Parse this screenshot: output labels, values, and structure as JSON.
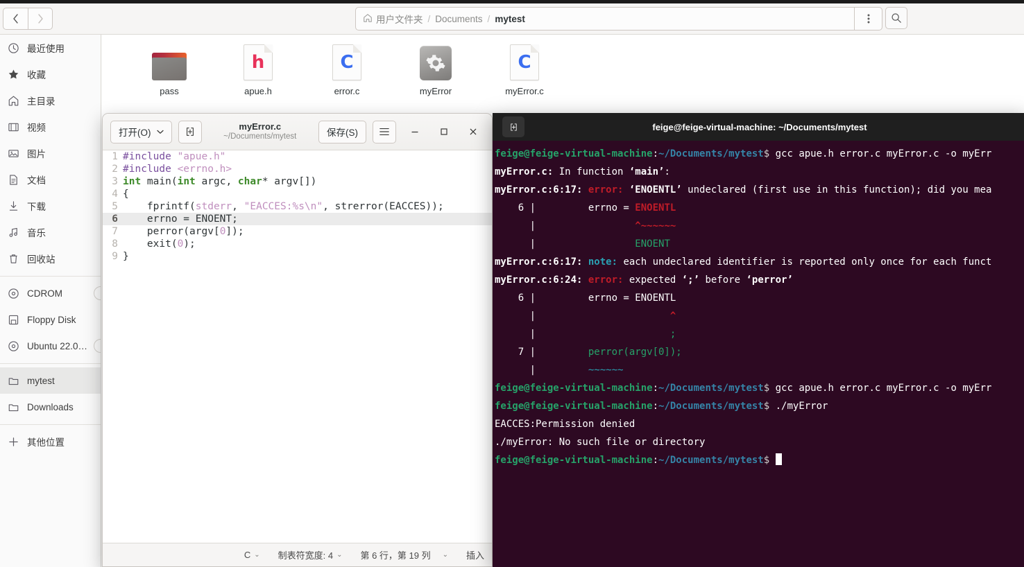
{
  "file_manager": {
    "nav": {
      "back_icon": "chevron-left-icon",
      "forward_icon": "chevron-right-icon"
    },
    "path": {
      "home_icon": "home-icon",
      "segments": [
        "用户文件夹",
        "Documents",
        "mytest"
      ],
      "separator": "/"
    },
    "menu_icon": "kebab-menu-icon",
    "search_icon": "search-icon",
    "sidebar": {
      "items": [
        {
          "label": "最近使用",
          "icon": "clock-icon",
          "selected": false,
          "eject": false
        },
        {
          "label": "收藏",
          "icon": "star-icon",
          "selected": false,
          "eject": false
        },
        {
          "label": "主目录",
          "icon": "home-icon",
          "selected": false,
          "eject": false
        },
        {
          "label": "视频",
          "icon": "video-icon",
          "selected": false,
          "eject": false
        },
        {
          "label": "图片",
          "icon": "image-icon",
          "selected": false,
          "eject": false
        },
        {
          "label": "文档",
          "icon": "document-icon",
          "selected": false,
          "eject": false
        },
        {
          "label": "下载",
          "icon": "download-icon",
          "selected": false,
          "eject": false
        },
        {
          "label": "音乐",
          "icon": "music-icon",
          "selected": false,
          "eject": false
        },
        {
          "label": "回收站",
          "icon": "trash-icon",
          "selected": false,
          "eject": false
        }
      ],
      "devices": [
        {
          "label": "CDROM",
          "icon": "disc-icon",
          "selected": false,
          "eject": true
        },
        {
          "label": "Floppy Disk",
          "icon": "floppy-icon",
          "selected": false,
          "eject": false
        },
        {
          "label": "Ubuntu 22.0…",
          "icon": "disc-icon",
          "selected": false,
          "eject": true
        }
      ],
      "bookmarks": [
        {
          "label": "mytest",
          "icon": "folder-icon",
          "selected": true,
          "eject": false
        },
        {
          "label": "Downloads",
          "icon": "folder-icon",
          "selected": false,
          "eject": false
        }
      ],
      "other": {
        "label": "其他位置",
        "icon": "plus-icon"
      }
    },
    "files": [
      {
        "name": "pass",
        "kind": "folder",
        "glyph": ""
      },
      {
        "name": "apue.h",
        "kind": "document",
        "glyph": "h"
      },
      {
        "name": "error.c",
        "kind": "document",
        "glyph": "C"
      },
      {
        "name": "myError",
        "kind": "executable",
        "glyph": "gear-icon"
      },
      {
        "name": "myError.c",
        "kind": "document",
        "glyph": "C"
      }
    ]
  },
  "editor": {
    "open_label": "打开(O)",
    "open_caret_icon": "chevron-down-icon",
    "new_tab_icon": "new-tab-icon",
    "title": "myError.c",
    "subtitle": "~/Documents/mytest",
    "save_label": "保存(S)",
    "hamburger_icon": "hamburger-menu-icon",
    "minimize_icon": "minimize-icon",
    "maximize_icon": "maximize-icon",
    "close_icon": "close-icon",
    "current_line": 6,
    "code_lines": [
      {
        "n": "1",
        "highlighted": false,
        "tokens": [
          {
            "t": "#include ",
            "c": "tok-pre"
          },
          {
            "t": "\"apue.h\"",
            "c": "tok-str"
          }
        ]
      },
      {
        "n": "2",
        "highlighted": false,
        "tokens": [
          {
            "t": "#include ",
            "c": "tok-pre"
          },
          {
            "t": "<errno.h>",
            "c": "tok-str"
          }
        ]
      },
      {
        "n": "3",
        "highlighted": false,
        "tokens": [
          {
            "t": "int",
            "c": "tok-kw"
          },
          {
            "t": " main(",
            "c": "tok-plain"
          },
          {
            "t": "int",
            "c": "tok-kw"
          },
          {
            "t": " argc, ",
            "c": "tok-plain"
          },
          {
            "t": "char",
            "c": "tok-kw"
          },
          {
            "t": "* argv[])",
            "c": "tok-plain"
          }
        ]
      },
      {
        "n": "4",
        "highlighted": false,
        "tokens": [
          {
            "t": "{",
            "c": "tok-plain"
          }
        ]
      },
      {
        "n": "5",
        "highlighted": false,
        "tokens": [
          {
            "t": "    fprintf(",
            "c": "tok-plain"
          },
          {
            "t": "stderr",
            "c": "tok-id"
          },
          {
            "t": ", ",
            "c": "tok-plain"
          },
          {
            "t": "\"EACCES:%s\\n\"",
            "c": "tok-str"
          },
          {
            "t": ", strerror(EACCES));",
            "c": "tok-plain"
          }
        ]
      },
      {
        "n": "6",
        "highlighted": true,
        "tokens": [
          {
            "t": "    errno = ENOENT;",
            "c": "tok-plain"
          }
        ]
      },
      {
        "n": "7",
        "highlighted": false,
        "tokens": [
          {
            "t": "    perror(argv[",
            "c": "tok-plain"
          },
          {
            "t": "0",
            "c": "tok-num"
          },
          {
            "t": "]);",
            "c": "tok-plain"
          }
        ]
      },
      {
        "n": "8",
        "highlighted": false,
        "tokens": [
          {
            "t": "    exit(",
            "c": "tok-plain"
          },
          {
            "t": "0",
            "c": "tok-num"
          },
          {
            "t": ");",
            "c": "tok-plain"
          }
        ]
      },
      {
        "n": "9",
        "highlighted": false,
        "tokens": [
          {
            "t": "}",
            "c": "tok-plain"
          }
        ]
      }
    ],
    "status": {
      "language": "C",
      "tab_width": "制表符宽度: 4",
      "position": "第 6 行，第 19 列",
      "mode": "插入"
    }
  },
  "terminal": {
    "tab_button_icon": "new-tab-icon",
    "title": "feige@feige-virtual-machine: ~/Documents/mytest",
    "prompt_user": "feige@feige-virtual-machine",
    "prompt_path": "~/Documents/mytest",
    "prompt_symbol": "$",
    "lines": [
      {
        "type": "prompt",
        "command": " gcc apue.h error.c myError.c -o myErr"
      },
      {
        "type": "plain",
        "spans": [
          {
            "t": "myError.c:",
            "c": "t-boldw"
          },
          {
            "t": " In function ",
            "c": "t-white"
          },
          {
            "t": "‘main’",
            "c": "t-boldw"
          },
          {
            "t": ":",
            "c": "t-white"
          }
        ]
      },
      {
        "type": "plain",
        "spans": [
          {
            "t": "myError.c:6:17: ",
            "c": "t-boldw"
          },
          {
            "t": "error: ",
            "c": "t-err"
          },
          {
            "t": "‘ENOENTL’",
            "c": "t-boldw"
          },
          {
            "t": " undeclared (first use in this function); did you mea",
            "c": "t-white"
          }
        ]
      },
      {
        "type": "plain",
        "spans": [
          {
            "t": "    6 |         errno = ",
            "c": "t-white"
          },
          {
            "t": "ENOENTL",
            "c": "t-red"
          }
        ]
      },
      {
        "type": "plain",
        "spans": [
          {
            "t": "      |                 ",
            "c": "t-white"
          },
          {
            "t": "^~~~~~~",
            "c": "t-red"
          }
        ]
      },
      {
        "type": "plain",
        "spans": [
          {
            "t": "      |                 ",
            "c": "t-white"
          },
          {
            "t": "ENOENT",
            "c": "t-green"
          }
        ]
      },
      {
        "type": "plain",
        "spans": [
          {
            "t": "myError.c:6:17: ",
            "c": "t-boldw"
          },
          {
            "t": "note: ",
            "c": "t-note"
          },
          {
            "t": "each undeclared identifier is reported only once for each funct",
            "c": "t-white"
          }
        ]
      },
      {
        "type": "plain",
        "spans": [
          {
            "t": "myError.c:6:24: ",
            "c": "t-boldw"
          },
          {
            "t": "error: ",
            "c": "t-err"
          },
          {
            "t": "expected ",
            "c": "t-white"
          },
          {
            "t": "‘;’",
            "c": "t-boldw"
          },
          {
            "t": " before ",
            "c": "t-white"
          },
          {
            "t": "‘perror’",
            "c": "t-boldw"
          }
        ]
      },
      {
        "type": "plain",
        "spans": [
          {
            "t": "    6 |         errno = ENOENTL",
            "c": "t-white"
          }
        ]
      },
      {
        "type": "plain",
        "spans": [
          {
            "t": "      |                       ",
            "c": "t-white"
          },
          {
            "t": "^",
            "c": "t-red"
          }
        ]
      },
      {
        "type": "plain",
        "spans": [
          {
            "t": "      |                       ",
            "c": "t-white"
          },
          {
            "t": ";",
            "c": "t-green"
          }
        ]
      },
      {
        "type": "plain",
        "spans": [
          {
            "t": "    7 |         ",
            "c": "t-white"
          },
          {
            "t": "perror(argv[0]);",
            "c": "t-green"
          }
        ]
      },
      {
        "type": "plain",
        "spans": [
          {
            "t": "      |         ",
            "c": "t-white"
          },
          {
            "t": "~~~~~~",
            "c": "t-cyan"
          }
        ]
      },
      {
        "type": "prompt",
        "command": " gcc apue.h error.c myError.c -o myErr"
      },
      {
        "type": "prompt",
        "command": " ./myError"
      },
      {
        "type": "plain",
        "spans": [
          {
            "t": "EACCES:Permission denied",
            "c": "t-white"
          }
        ]
      },
      {
        "type": "plain",
        "spans": [
          {
            "t": "./myError: No such file or directory",
            "c": "t-white"
          }
        ]
      },
      {
        "type": "prompt-cursor",
        "command": " "
      }
    ]
  }
}
